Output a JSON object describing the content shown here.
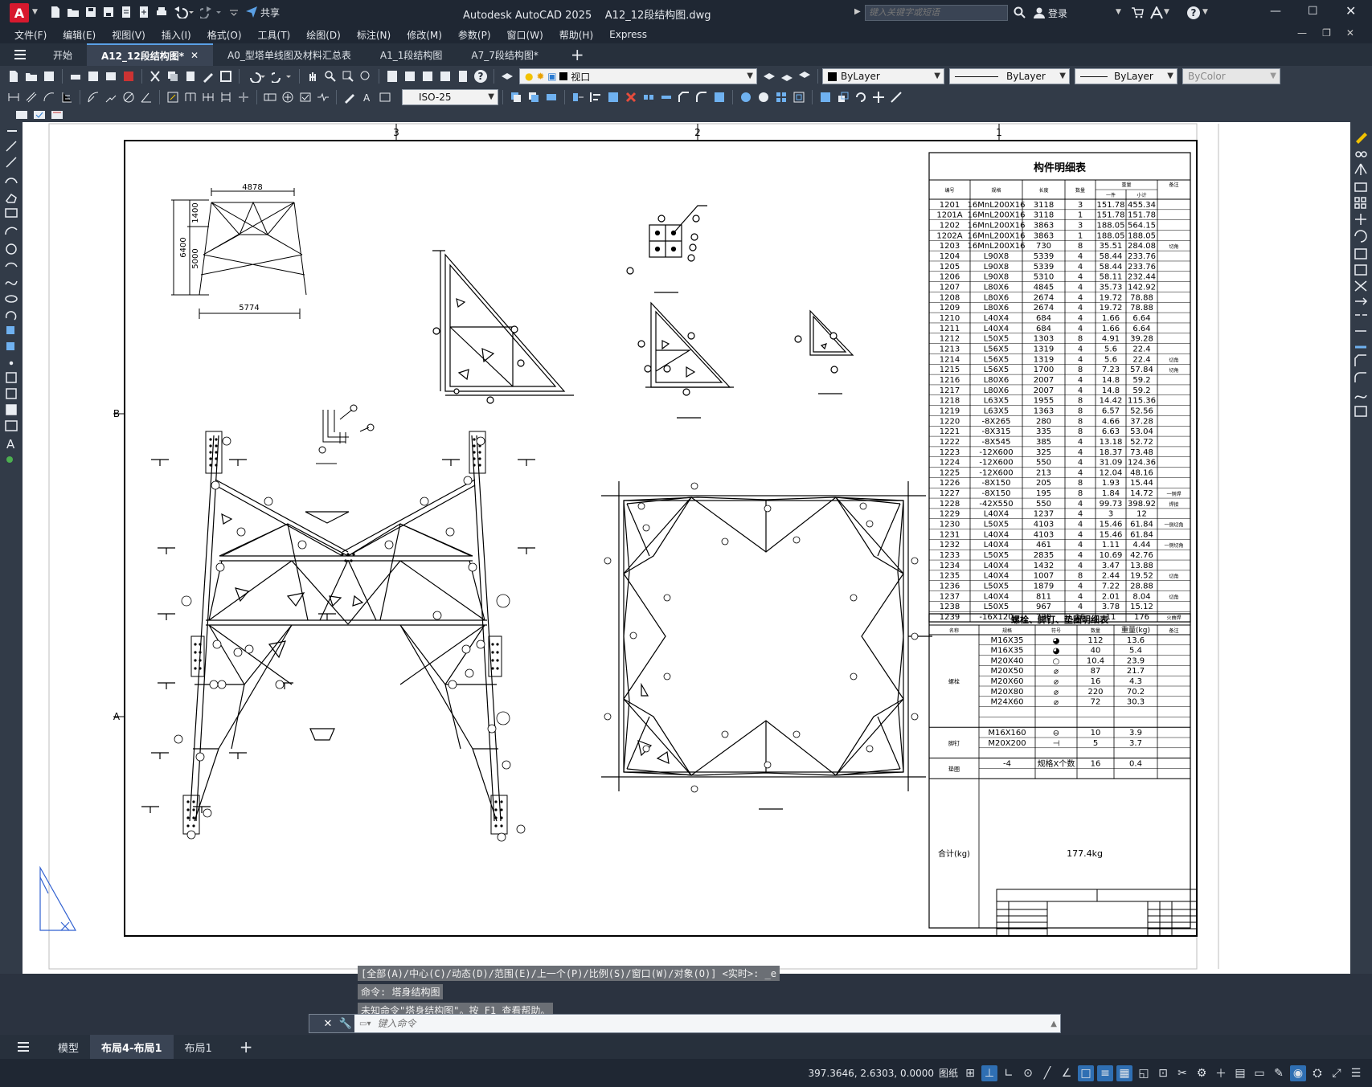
{
  "app": {
    "title": "Autodesk AutoCAD 2025",
    "filename": "A12_12段结构图.dwg",
    "share_label": "共享",
    "search_placeholder": "键入关键字或短语",
    "login_label": "登录",
    "logo_letter": "A",
    "accent": "#d7192e"
  },
  "menu": [
    "文件(F)",
    "编辑(E)",
    "视图(V)",
    "插入(I)",
    "格式(O)",
    "工具(T)",
    "绘图(D)",
    "标注(N)",
    "修改(M)",
    "参数(P)",
    "窗口(W)",
    "帮助(H)",
    "Express"
  ],
  "doc_tabs": [
    {
      "label": "开始",
      "active": false,
      "closable": false
    },
    {
      "label": "A12_12段结构图*",
      "active": true,
      "closable": true
    },
    {
      "label": "A0_型塔单线图及材料汇总表",
      "active": false,
      "closable": false
    },
    {
      "label": "A1_1段结构图",
      "active": false,
      "closable": false
    },
    {
      "label": "A7_7段结构图*",
      "active": false,
      "closable": false
    }
  ],
  "toolbar": {
    "layer_value": "视口",
    "color_value": "ByLayer",
    "linetype_value": "ByLayer",
    "lineweight_value": "ByLayer",
    "plotstyle_value": "ByColor",
    "dimstyle_value": "ISO-25"
  },
  "drawing": {
    "col_markers": [
      "3",
      "2",
      "1"
    ],
    "row_markers": [
      "B",
      "A"
    ],
    "dims": {
      "top_width": "4878",
      "bottom_width": "5774",
      "h1": "1400",
      "h2": "6400",
      "h3": "5000"
    },
    "parts_table": {
      "title": "构件明细表",
      "headers": [
        "编号",
        "规格",
        "长度",
        "数量",
        "重量",
        "备注"
      ],
      "weight_sub": [
        "一件",
        "小计"
      ],
      "rows": [
        [
          "1201",
          "16MnL200X16",
          "3118",
          "3",
          "151.78",
          "455.34",
          ""
        ],
        [
          "1201A",
          "16MnL200X16",
          "3118",
          "1",
          "151.78",
          "151.78",
          ""
        ],
        [
          "1202",
          "16MnL200X16",
          "3863",
          "3",
          "188.05",
          "564.15",
          ""
        ],
        [
          "1202A",
          "16MnL200X16",
          "3863",
          "1",
          "188.05",
          "188.05",
          ""
        ],
        [
          "1203",
          "16MnL200X16",
          "730",
          "8",
          "35.51",
          "284.08",
          "切角"
        ],
        [
          "1204",
          "L90X8",
          "5339",
          "4",
          "58.44",
          "233.76",
          ""
        ],
        [
          "1205",
          "L90X8",
          "5339",
          "4",
          "58.44",
          "233.76",
          ""
        ],
        [
          "1206",
          "L90X8",
          "5310",
          "4",
          "58.11",
          "232.44",
          ""
        ],
        [
          "1207",
          "L80X6",
          "4845",
          "4",
          "35.73",
          "142.92",
          ""
        ],
        [
          "1208",
          "L80X6",
          "2674",
          "4",
          "19.72",
          "78.88",
          ""
        ],
        [
          "1209",
          "L80X6",
          "2674",
          "4",
          "19.72",
          "78.88",
          ""
        ],
        [
          "1210",
          "L40X4",
          "684",
          "4",
          "1.66",
          "6.64",
          ""
        ],
        [
          "1211",
          "L40X4",
          "684",
          "4",
          "1.66",
          "6.64",
          ""
        ],
        [
          "1212",
          "L50X5",
          "1303",
          "8",
          "4.91",
          "39.28",
          ""
        ],
        [
          "1213",
          "L56X5",
          "1319",
          "4",
          "5.6",
          "22.4",
          ""
        ],
        [
          "1214",
          "L56X5",
          "1319",
          "4",
          "5.6",
          "22.4",
          "切角"
        ],
        [
          "1215",
          "L56X5",
          "1700",
          "8",
          "7.23",
          "57.84",
          "切角"
        ],
        [
          "1216",
          "L80X6",
          "2007",
          "4",
          "14.8",
          "59.2",
          ""
        ],
        [
          "1217",
          "L80X6",
          "2007",
          "4",
          "14.8",
          "59.2",
          ""
        ],
        [
          "1218",
          "L63X5",
          "1955",
          "8",
          "14.42",
          "115.36",
          ""
        ],
        [
          "1219",
          "L63X5",
          "1363",
          "8",
          "6.57",
          "52.56",
          ""
        ],
        [
          "1220",
          "-8X265",
          "280",
          "8",
          "4.66",
          "37.28",
          ""
        ],
        [
          "1221",
          "-8X315",
          "335",
          "8",
          "6.63",
          "53.04",
          ""
        ],
        [
          "1222",
          "-8X545",
          "385",
          "4",
          "13.18",
          "52.72",
          ""
        ],
        [
          "1223",
          "-12X600",
          "325",
          "4",
          "18.37",
          "73.48",
          ""
        ],
        [
          "1224",
          "-12X600",
          "550",
          "4",
          "31.09",
          "124.36",
          ""
        ],
        [
          "1225",
          "-12X600",
          "213",
          "4",
          "12.04",
          "48.16",
          ""
        ],
        [
          "1226",
          "-8X150",
          "205",
          "8",
          "1.93",
          "15.44",
          ""
        ],
        [
          "1227",
          "-8X150",
          "195",
          "8",
          "1.84",
          "14.72",
          "一侧焊"
        ],
        [
          "1228",
          "-42X550",
          "550",
          "4",
          "99.73",
          "398.92",
          "焊接"
        ],
        [
          "1229",
          "L40X4",
          "1237",
          "4",
          "3",
          "12",
          ""
        ],
        [
          "1230",
          "L50X5",
          "4103",
          "4",
          "15.46",
          "61.84",
          "一侧切角"
        ],
        [
          "1231",
          "L40X4",
          "4103",
          "4",
          "15.46",
          "61.84",
          ""
        ],
        [
          "1232",
          "L40X4",
          "461",
          "4",
          "1.11",
          "4.44",
          "一侧切角"
        ],
        [
          "1233",
          "L50X5",
          "2835",
          "4",
          "10.69",
          "42.76",
          ""
        ],
        [
          "1234",
          "L40X4",
          "1432",
          "4",
          "3.47",
          "13.88",
          ""
        ],
        [
          "1235",
          "L40X4",
          "1007",
          "8",
          "2.44",
          "19.52",
          "切角"
        ],
        [
          "1236",
          "L50X5",
          "1879",
          "4",
          "7.22",
          "28.88",
          ""
        ],
        [
          "1237",
          "L40X4",
          "811",
          "4",
          "2.01",
          "8.04",
          "切角"
        ],
        [
          "1238",
          "L50X5",
          "967",
          "4",
          "3.78",
          "15.12",
          ""
        ],
        [
          "1239",
          "-16X120",
          "730",
          "16",
          "11",
          "176",
          "火曲焊"
        ]
      ]
    },
    "bolt_table": {
      "title": "螺栓、脚钉、垫圈明细表",
      "headers": [
        "名称",
        "规格",
        "符号",
        "数量",
        "重量(kg)",
        "备注"
      ],
      "groups": [
        {
          "name": "螺栓",
          "rows": [
            [
              "M16X35",
              "◕",
              "112",
              "13.6"
            ],
            [
              "M16X35",
              "◕",
              "40",
              "5.4"
            ],
            [
              "M20X40",
              "○",
              "10.4",
              "23.9"
            ],
            [
              "M20X50",
              "⌀",
              "87",
              "21.7"
            ],
            [
              "M20X60",
              "⌀",
              "16",
              "4.3"
            ],
            [
              "M20X80",
              "⌀",
              "220",
              "70.2"
            ],
            [
              "M24X60",
              "⌀",
              "72",
              "30.3"
            ]
          ]
        },
        {
          "name": "脚钉",
          "rows": [
            [
              "M16X160",
              "⊖",
              "10",
              "3.9"
            ],
            [
              "M20X200",
              "⊣",
              "5",
              "3.7"
            ]
          ]
        },
        {
          "name": "垫圈",
          "rows": [
            [
              "-4",
              "规格X个数",
              "16",
              "0.4"
            ]
          ]
        }
      ],
      "total_label": "合计(kg)",
      "total_value": "177.4kg"
    }
  },
  "command": {
    "history": [
      "[全部(A)/中心(C)/动态(D)/范围(E)/上一个(P)/比例(S)/窗口(W)/对象(O)] <实时>: _e",
      "命令: 塔身结构图",
      "未知命令\"塔身结构图\"。按 F1 查看帮助。"
    ],
    "placeholder": "键入命令"
  },
  "layout_tabs": [
    {
      "label": "模型",
      "active": false
    },
    {
      "label": "布局4-布局1",
      "active": true
    },
    {
      "label": "布局1",
      "active": false
    }
  ],
  "status": {
    "coords": "397.3646, 2.6303, 0.0000",
    "space": "图纸"
  }
}
